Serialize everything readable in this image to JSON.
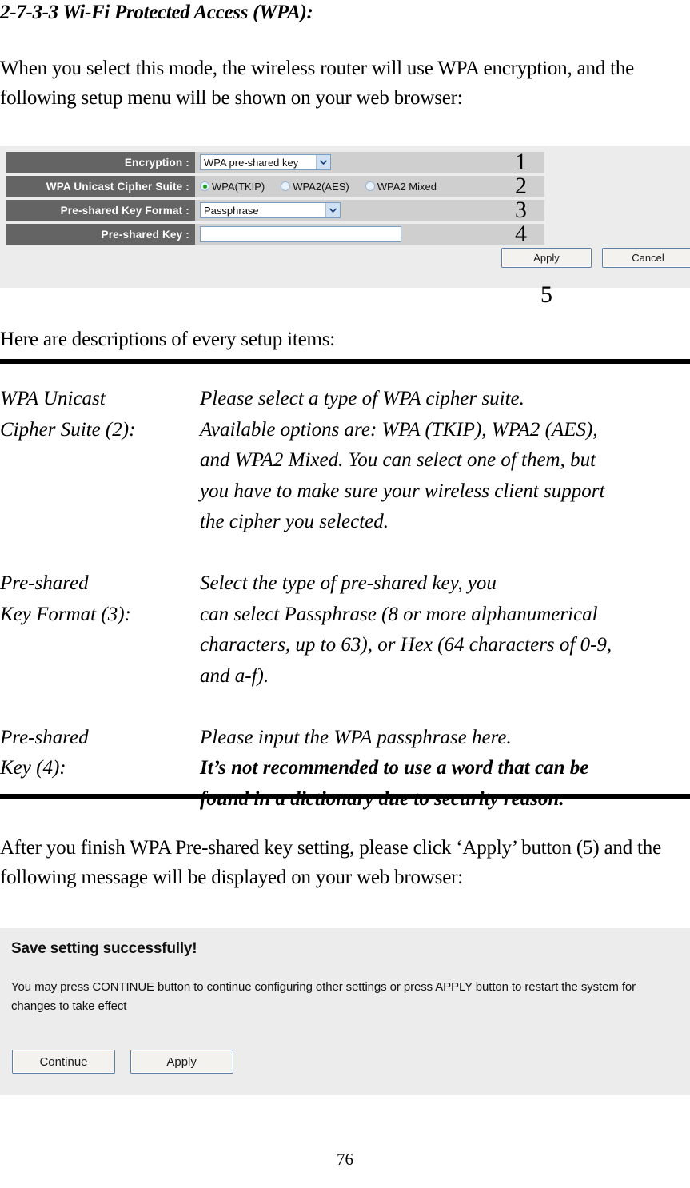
{
  "document": {
    "section_title": "2-7-3-3 Wi-Fi Protected Access (WPA):",
    "intro_paragraph": "When you select this mode, the wireless router will use WPA encryption, and the following setup menu will be shown on your web browser:",
    "descriptions_lead": "Here are descriptions of every setup items:",
    "after_paragraph": "After you finish WPA Pre-shared key setting, please click ‘Apply’ button (5) and the following message will be displayed on your web browser:",
    "page_number": "76"
  },
  "setup_form": {
    "rows": [
      {
        "label": "Encryption :",
        "control": "select",
        "value": "WPA pre-shared key",
        "marker": "1"
      },
      {
        "label": "WPA Unicast Cipher Suite :",
        "control": "radio-group",
        "marker": "2",
        "options": [
          {
            "label": "WPA(TKIP)",
            "checked": true
          },
          {
            "label": "WPA2(AES)",
            "checked": false
          },
          {
            "label": "WPA2 Mixed",
            "checked": false
          }
        ]
      },
      {
        "label": "Pre-shared Key Format :",
        "control": "select",
        "value": "Passphrase",
        "marker": "3"
      },
      {
        "label": "Pre-shared Key :",
        "control": "text",
        "value": "",
        "placeholder": "",
        "marker": "4"
      }
    ],
    "apply_label": "Apply",
    "cancel_label": "Cancel",
    "buttons_marker": "5",
    "colors": {
      "label_bg": "#646464",
      "label_text": "#ffffff",
      "field_bg": "#cfcfcf",
      "panel_bg": "#ececec",
      "input_border": "#7a9dc4",
      "radio_selected_dot": "#15a015"
    }
  },
  "definitions": [
    {
      "term_line1": "WPA Unicast",
      "term_line2": "Cipher Suite (2):",
      "desc_lines": [
        "Please select a type of WPA cipher suite.",
        "Available options are: WPA (TKIP), WPA2 (AES),",
        "and WPA2 Mixed. You can select one of them, but",
        "you have to make sure your wireless client support",
        "the cipher you selected."
      ],
      "bold": false
    },
    {
      "term_line1": "Pre-shared",
      "term_line2": "Key Format (3):",
      "desc_lines": [
        "Select the type of pre-shared key, you",
        "can select Passphrase (8 or more alphanumerical",
        "characters, up to 63), or Hex (64 characters of 0-9,",
        "and a-f)."
      ],
      "bold": false
    },
    {
      "term_line1": "Pre-shared",
      "term_line2": "Key (4):",
      "desc_lines": [
        "Please input the WPA passphrase here.",
        "It’s not recommended to use a word that can be",
        "found in a dictionary due to security reason."
      ],
      "bold_from_line": 1
    }
  ],
  "result_panel": {
    "title": "Save setting successfully!",
    "body": "You may press CONTINUE button to continue configuring other settings or press APPLY button to restart the system for changes to take effect",
    "continue_label": "Continue",
    "apply_label": "Apply"
  }
}
